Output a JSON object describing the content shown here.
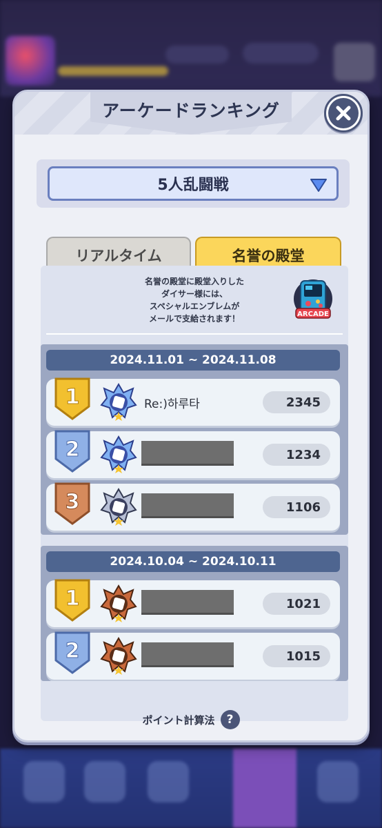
{
  "modal": {
    "title": "アーケードランキング",
    "mode_select": "5人乱闘戦",
    "tabs": [
      {
        "label": "リアルタイム",
        "active": false
      },
      {
        "label": "名誉の殿堂",
        "active": true
      }
    ],
    "notice_lines": [
      "名誉の殿堂に殿堂入りした",
      "ダイサー様には、",
      "スペシャルエンブレムが",
      "メールで支給されます！"
    ],
    "arcade_icon_label": "ARCADE",
    "weeks": [
      {
        "period": "2024.11.01 ~ 2024.11.08",
        "entries": [
          {
            "rank": "1",
            "name": "Re:)하루타",
            "score": "2345"
          },
          {
            "rank": "2",
            "name": "",
            "score": "1234"
          },
          {
            "rank": "3",
            "name": "",
            "score": "1106"
          }
        ]
      },
      {
        "period": "2024.10.04 ~ 2024.10.11",
        "entries": [
          {
            "rank": "1",
            "name": "",
            "score": "1021"
          },
          {
            "rank": "2",
            "name": "",
            "score": "1015"
          }
        ]
      }
    ],
    "footer_link": "ポイント計算法",
    "help_icon": "?"
  },
  "colors": {
    "gold": "#f2c02f",
    "silver": "#8fb0e6",
    "bronze": "#d58a5c",
    "tab_active": "#fbd65b",
    "header_bar": "#4e6590"
  }
}
